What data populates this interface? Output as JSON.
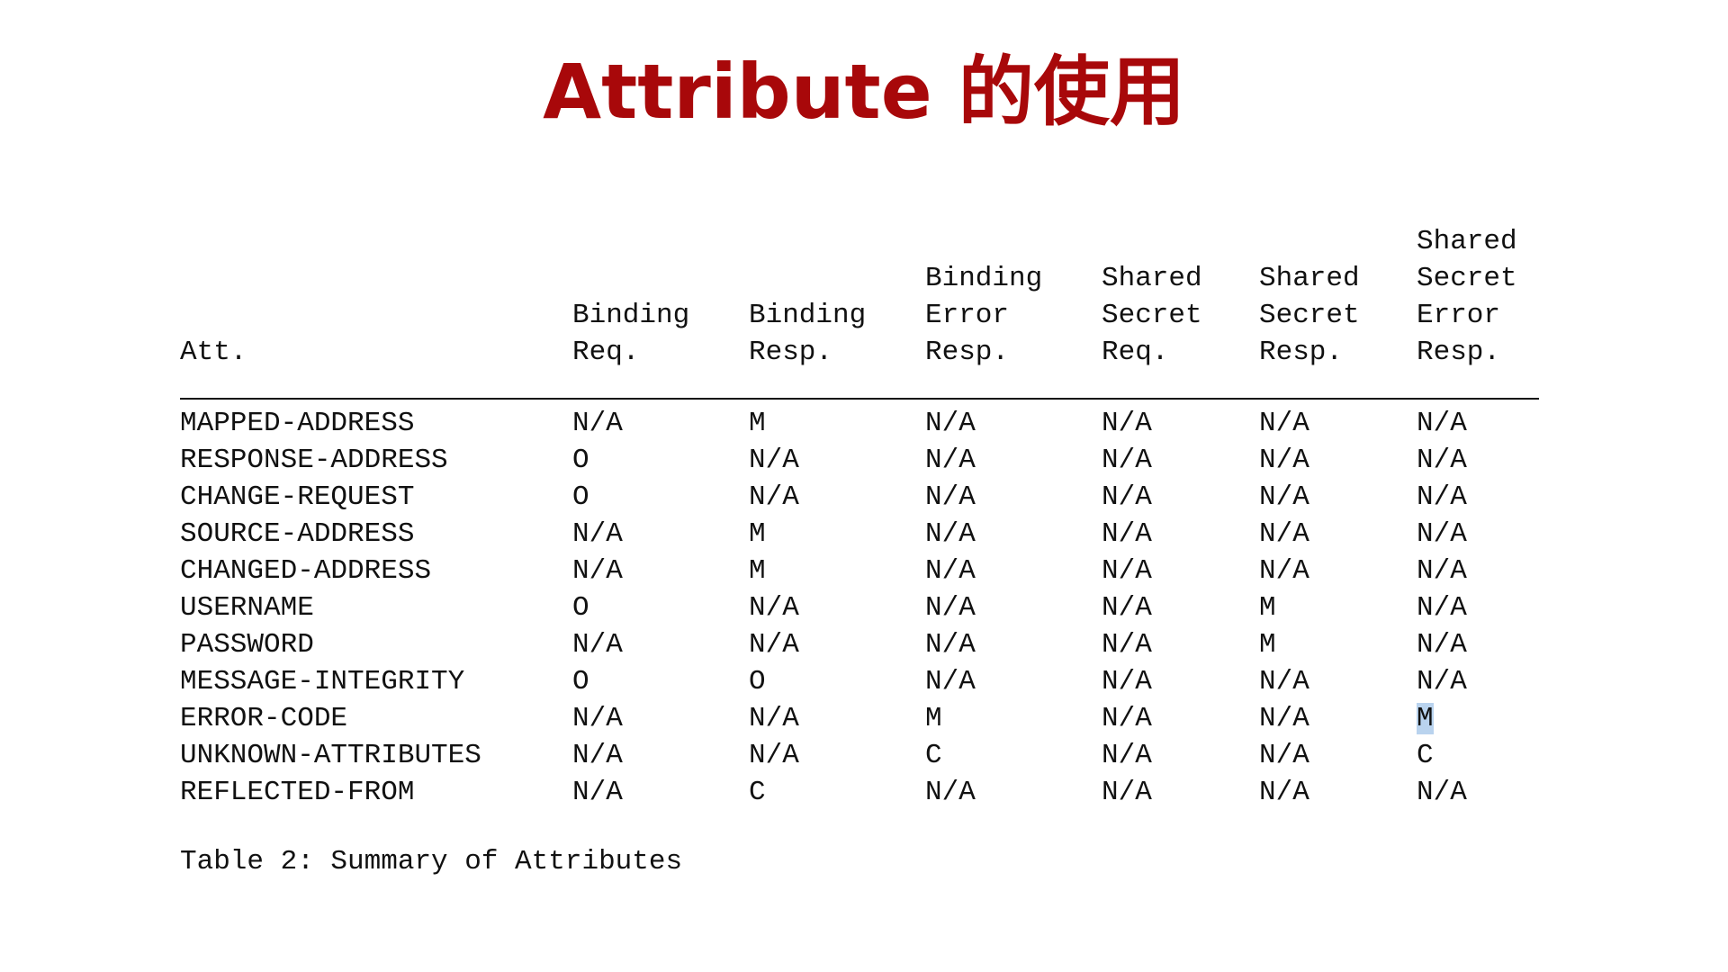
{
  "title": "Attribute 的使用",
  "table": {
    "headers": [
      "Att.",
      "Binding\nReq.",
      "Binding\nResp.",
      "Binding\nError\nResp.",
      "Shared\nSecret\nReq.",
      "Shared\nSecret\nResp.",
      "Shared\nSecret\nError\nResp."
    ],
    "rows": [
      [
        "MAPPED-ADDRESS",
        "N/A",
        "M",
        "N/A",
        "N/A",
        "N/A",
        "N/A"
      ],
      [
        "RESPONSE-ADDRESS",
        "O",
        "N/A",
        "N/A",
        "N/A",
        "N/A",
        "N/A"
      ],
      [
        "CHANGE-REQUEST",
        "O",
        "N/A",
        "N/A",
        "N/A",
        "N/A",
        "N/A"
      ],
      [
        "SOURCE-ADDRESS",
        "N/A",
        "M",
        "N/A",
        "N/A",
        "N/A",
        "N/A"
      ],
      [
        "CHANGED-ADDRESS",
        "N/A",
        "M",
        "N/A",
        "N/A",
        "N/A",
        "N/A"
      ],
      [
        "USERNAME",
        "O",
        "N/A",
        "N/A",
        "N/A",
        "M",
        "N/A"
      ],
      [
        "PASSWORD",
        "N/A",
        "N/A",
        "N/A",
        "N/A",
        "M",
        "N/A"
      ],
      [
        "MESSAGE-INTEGRITY",
        "O",
        "O",
        "N/A",
        "N/A",
        "N/A",
        "N/A"
      ],
      [
        "ERROR-CODE",
        "N/A",
        "N/A",
        "M",
        "N/A",
        "N/A",
        "M"
      ],
      [
        "UNKNOWN-ATTRIBUTES",
        "N/A",
        "N/A",
        "C",
        "N/A",
        "N/A",
        "C"
      ],
      [
        "REFLECTED-FROM",
        "N/A",
        "C",
        "N/A",
        "N/A",
        "N/A",
        "N/A"
      ]
    ],
    "caption": "Table 2: Summary of Attributes"
  },
  "colors": {
    "title": "#a8080a",
    "text": "#111111",
    "selection_highlight": "#b9d3ee"
  }
}
